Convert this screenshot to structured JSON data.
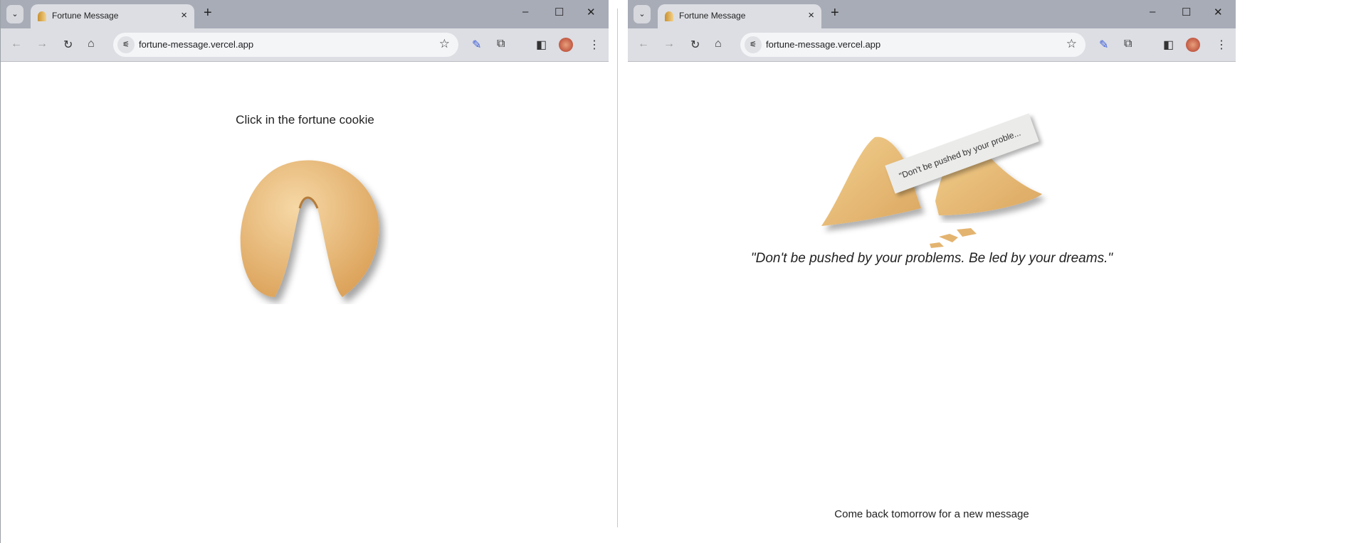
{
  "windows": [
    {
      "tab_title": "Fortune Message",
      "url": "fortune-message.vercel.app",
      "prompt": "Click in the fortune cookie"
    },
    {
      "tab_title": "Fortune Message",
      "url": "fortune-message.vercel.app",
      "slip_text": "\"Don't be pushed by your proble...",
      "message": "\"Don't be pushed by your problems. Be led by your dreams.\"",
      "footer": "Come back tomorrow for a new message"
    }
  ],
  "icons": {
    "tab_search": "chevron-down-icon",
    "close": "×",
    "new_tab": "+",
    "minimize": "–",
    "maximize": "☐",
    "window_close": "✕",
    "back": "←",
    "forward": "→",
    "reload": "↻",
    "home": "⌂",
    "site_info": "⚟",
    "star": "☆",
    "menu": "⋮"
  },
  "colors": {
    "chrome_frame": "#a8acb7",
    "toolbar": "#dcdee3",
    "cookie": "#e9bb72"
  }
}
